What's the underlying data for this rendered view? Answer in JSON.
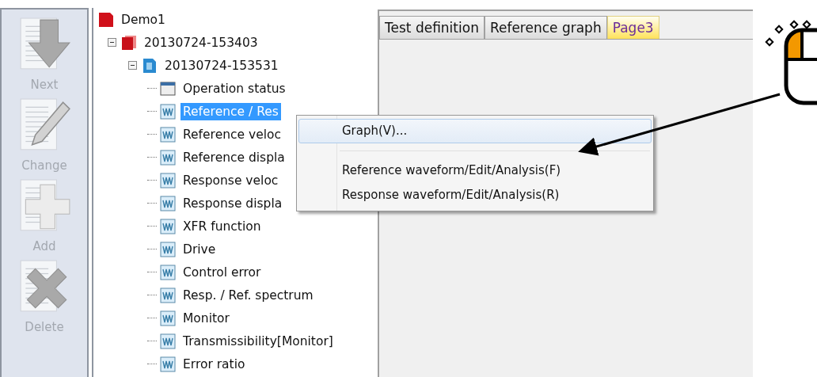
{
  "toolbar": [
    {
      "label": "Next",
      "disabled": true
    },
    {
      "label": "Change",
      "disabled": true
    },
    {
      "label": "Add",
      "disabled": true
    },
    {
      "label": "Delete",
      "disabled": true
    }
  ],
  "tree": {
    "items": [
      {
        "label": "Demo1",
        "kind": "project",
        "selected": false,
        "children": [
          {
            "label": "20130724-153403",
            "kind": "test",
            "selected": false,
            "expanded": true,
            "children": [
              {
                "label": "20130724-153531",
                "kind": "run",
                "selected": false,
                "expanded": true,
                "children": [
                  {
                    "label": "Operation status",
                    "kind": "status",
                    "selected": false
                  },
                  {
                    "label": "Reference / Res",
                    "kind": "wave",
                    "selected": true
                  },
                  {
                    "label": "Reference veloc",
                    "kind": "wave",
                    "selected": false
                  },
                  {
                    "label": "Reference displa",
                    "kind": "wave",
                    "selected": false
                  },
                  {
                    "label": "Response veloc",
                    "kind": "wave",
                    "selected": false
                  },
                  {
                    "label": "Response displa",
                    "kind": "wave",
                    "selected": false
                  },
                  {
                    "label": "XFR function",
                    "kind": "wave",
                    "selected": false
                  },
                  {
                    "label": "Drive",
                    "kind": "wave",
                    "selected": false
                  },
                  {
                    "label": "Control error",
                    "kind": "wave",
                    "selected": false
                  },
                  {
                    "label": "Resp. / Ref. spectrum",
                    "kind": "wave",
                    "selected": false
                  },
                  {
                    "label": "Monitor",
                    "kind": "wave",
                    "selected": false
                  },
                  {
                    "label": "Transmissibility[Monitor]",
                    "kind": "wave",
                    "selected": false
                  },
                  {
                    "label": "Error ratio",
                    "kind": "wave",
                    "selected": false
                  }
                ]
              }
            ]
          }
        ]
      }
    ]
  },
  "tabs": [
    {
      "label": "Test definition",
      "selected": false
    },
    {
      "label": "Reference graph",
      "selected": false
    },
    {
      "label": "Page3",
      "selected": true
    }
  ],
  "context_menu": [
    {
      "label": "Graph(V)...",
      "selected": true,
      "separator_after": true
    },
    {
      "label": "Reference waveform/Edit/Analysis(F)",
      "selected": false,
      "separator_after": false
    },
    {
      "label": "Response waveform/Edit/Analysis(R)",
      "selected": false,
      "separator_after": false
    }
  ]
}
